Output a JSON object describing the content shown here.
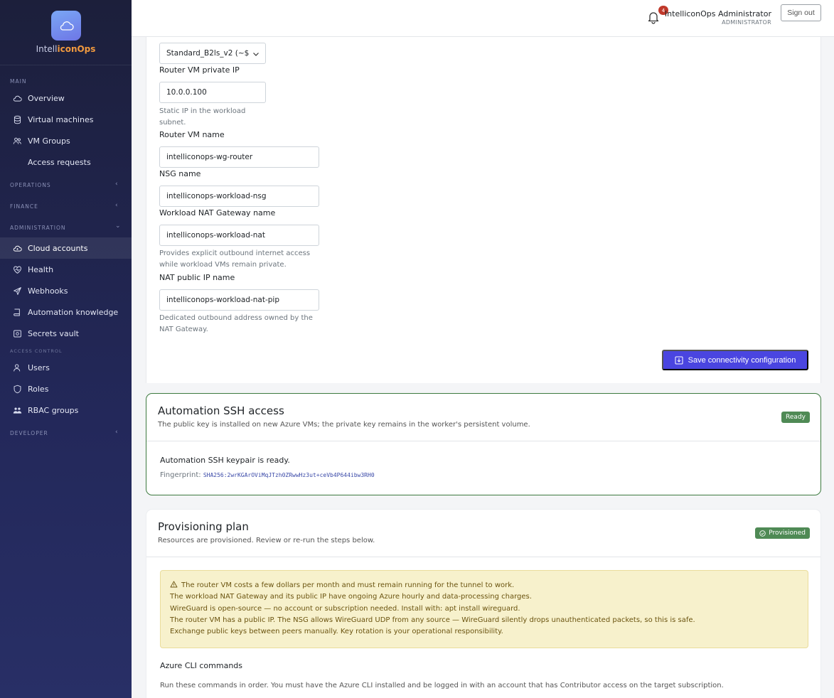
{
  "brand": {
    "name_part1": "Intell",
    "name_part2": "iconOps"
  },
  "sidebar": {
    "sections": {
      "main": "MAIN",
      "operations": "OPERATIONS",
      "finance": "FINANCE",
      "administration": "ADMINISTRATION",
      "access_control": "ACCESS CONTROL",
      "developer": "DEVELOPER"
    },
    "items": {
      "overview": "Overview",
      "virtual_machines": "Virtual machines",
      "vm_groups": "VM Groups",
      "access_requests": "Access requests",
      "cloud_accounts": "Cloud accounts",
      "health": "Health",
      "webhooks": "Webhooks",
      "automation_knowledge": "Automation knowledge",
      "secrets_vault": "Secrets vault",
      "users": "Users",
      "roles": "Roles",
      "rbac_groups": "RBAC groups"
    },
    "active_item": "cloud_accounts"
  },
  "topbar": {
    "notification_count": "4",
    "user_name": "IntelliconOps Administrator",
    "user_role": "ADMINISTRATOR",
    "signout_label": "Sign out"
  },
  "form": {
    "vm_size_value": "Standard_B2ls_v2 (~$",
    "router_ip_label": "Router VM private IP",
    "router_ip_value": "10.0.0.100",
    "router_ip_help": "Static IP in the workload subnet.",
    "router_name_label": "Router VM name",
    "router_name_value": "intelliconops-wg-router",
    "nsg_label": "NSG name",
    "nsg_value": "intelliconops-workload-nsg",
    "nat_label": "Workload NAT Gateway name",
    "nat_value": "intelliconops-workload-nat",
    "nat_help": "Provides explicit outbound internet access while workload VMs remain private.",
    "nat_ip_label": "NAT public IP name",
    "nat_ip_value": "intelliconops-workload-nat-pip",
    "nat_ip_help": "Dedicated outbound address owned by the NAT Gateway.",
    "save_label": "Save connectivity configuration"
  },
  "ssh_card": {
    "title": "Automation SSH access",
    "subtitle": "The public key is installed on new Azure VMs; the private key remains in the worker's persistent volume.",
    "status": "Ready",
    "status_color": "#4f8a55",
    "message": "Automation SSH keypair is ready.",
    "fingerprint_label": "Fingerprint:",
    "fingerprint_value": "SHA256:2wrKGArOViMqJTzh0ZRwwHz3ut+ceVb4P644ibw3RH0"
  },
  "plan_card": {
    "title": "Provisioning plan",
    "subtitle": "Resources are provisioned. Review or re-run the steps below.",
    "status": "Provisioned",
    "warnings": [
      "The router VM costs a few dollars per month and must remain running for the tunnel to work.",
      "The workload NAT Gateway and its public IP have ongoing Azure hourly and data-processing charges.",
      "WireGuard is open-source — no account or subscription needed. Install with: apt install wireguard.",
      "The router VM has a public IP. The NSG allows WireGuard UDP from any source — WireGuard silently drops unauthenticated packets, so this is safe.",
      "Exchange public keys between peers manually. Key rotation is your operational responsibility."
    ],
    "cli_title": "Azure CLI commands",
    "cli_text": "Run these commands in order. You must have the Azure CLI installed and be logged in with an account that has Contributor access on the target subscription."
  },
  "colors": {
    "sidebar_bg": "#1c1f3b",
    "primary_button": "#4a45e0",
    "brand_accent": "#f29a3f",
    "success": "#4f8a55",
    "warning_bg": "#f7f1cc"
  }
}
